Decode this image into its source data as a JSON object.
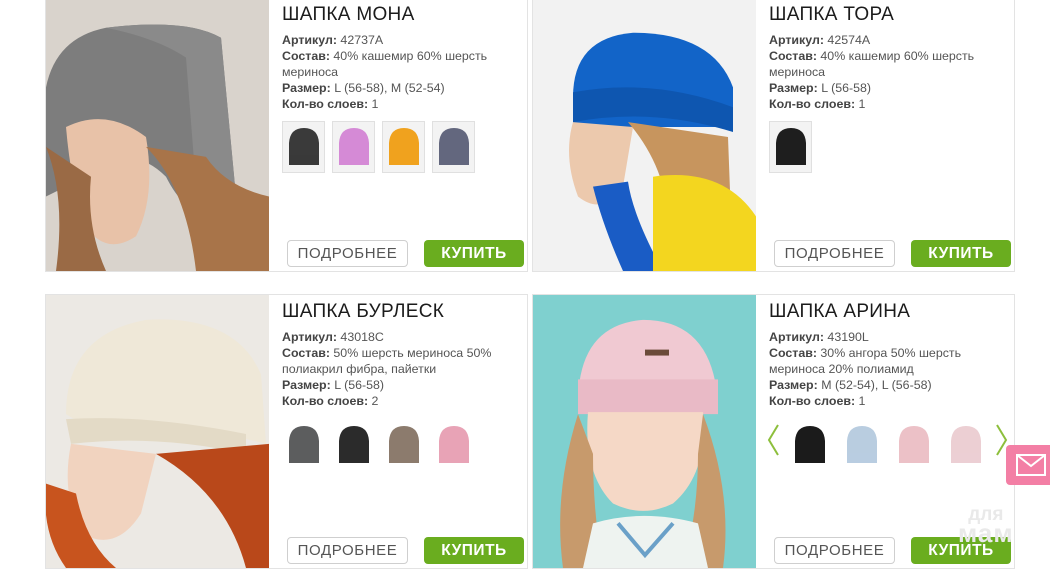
{
  "labels": {
    "sku": "Артикул:",
    "composition": "Состав:",
    "size": "Размер:",
    "layers": "Кол-во слоев:"
  },
  "buttons": {
    "more": "ПОДРОБНЕЕ",
    "buy": "КУПИТЬ"
  },
  "products": [
    {
      "title": "ШАПКА МОНА",
      "sku": "42737A",
      "composition": "40% кашемир 60% шерсть мериноса",
      "size": "L (56-58), M (52-54)",
      "layers": "1",
      "swatch_colors": [
        "#3a3a3a",
        "#d58ad6",
        "#f0a21e",
        "#63677e"
      ]
    },
    {
      "title": "ШАПКА ТОРА",
      "sku": "42574A",
      "composition": "40% кашемир 60% шерсть мериноса",
      "size": "L (56-58)",
      "layers": "1",
      "swatch_colors": [
        "#1e1e1e"
      ]
    },
    {
      "title": "ШАПКА БУРЛЕСК",
      "sku": "43018C",
      "composition": "50% шерсть мериноса 50% полиакрил фибра, пайетки",
      "size": "L (56-58)",
      "layers": "2",
      "swatch_colors": [
        "#5c5d5e",
        "#2b2b2b",
        "#8c7b6d",
        "#e8a3b6"
      ]
    },
    {
      "title": "ШАПКА АРИНА",
      "sku": "43190L",
      "composition": "30% ангора 50% шерсть мериноса 20% полиамид",
      "size": "M (52-54), L (56-58)",
      "layers": "1",
      "swatch_colors": [
        "#1b1b1b",
        "#b9cde0",
        "#ecc1c7",
        "#eccfd3"
      ]
    }
  ],
  "watermark": {
    "line1": "для",
    "line2": "мам"
  },
  "icons": {
    "carousel_prev": "chevron-left-icon",
    "carousel_next": "chevron-right-icon",
    "mail": "envelope-icon"
  }
}
